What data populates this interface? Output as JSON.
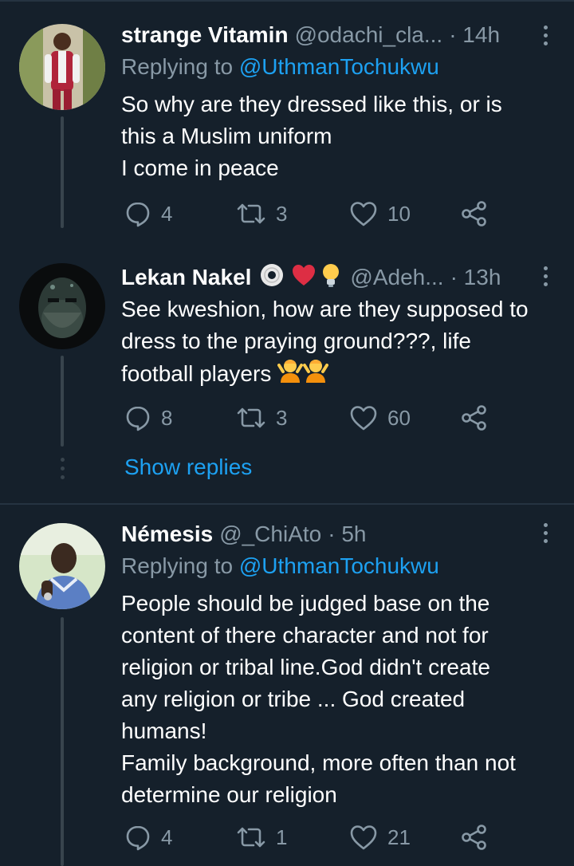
{
  "tweets": [
    {
      "name": "strange Vitamin",
      "handle": "@odachi_cla...",
      "time": "· 14h",
      "replying_prefix": "Replying to ",
      "replying_to": "@UthmanTochukwu",
      "lines": [
        "So why are they dressed like this, or is",
        "this a Muslim uniform",
        "I come in peace"
      ],
      "replies": "4",
      "retweets": "3",
      "likes": "10"
    },
    {
      "name": "Lekan Nakel",
      "handle": "@Adeh...",
      "time": "· 13h",
      "lines": [
        "See kweshion, how are they supposed to",
        "dress to the praying ground???, life",
        "football players"
      ],
      "replies": "8",
      "retweets": "3",
      "likes": "60"
    },
    {
      "name": "Némesis",
      "handle": "@_ChiAto",
      "time": "· 5h",
      "replying_prefix": "Replying to ",
      "replying_to": "@UthmanTochukwu",
      "lines": [
        "People should be judged base on the",
        "content of there character and not for",
        "religion or tribal line.God didn't create",
        "any religion or tribe ... God created",
        "humans!",
        "Family background, more often than not",
        "determine our religion"
      ],
      "replies": "4",
      "retweets": "1",
      "likes": "21"
    }
  ],
  "show_replies_label": "Show replies",
  "colors": {
    "background": "#15202b",
    "secondary_text": "#8899a6",
    "accent": "#1da1f2",
    "divider": "#253341"
  }
}
